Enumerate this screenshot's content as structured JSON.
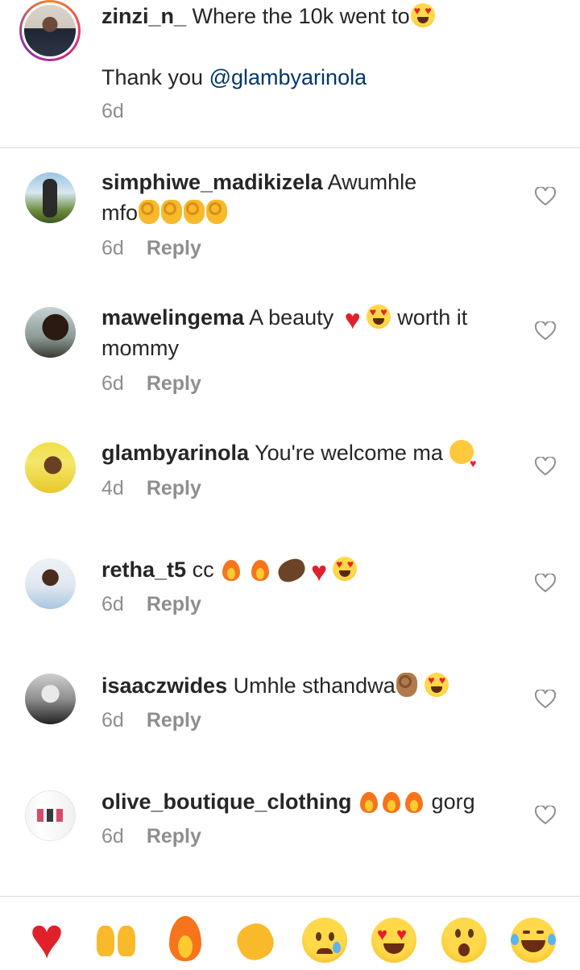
{
  "caption": {
    "username": "zinzi_n_",
    "text": "Where the 10k went to",
    "thanks": "Thank you",
    "mention": "@glambyarinola",
    "time": "6d"
  },
  "comments": [
    {
      "username": "simphiwe_madikizela",
      "text": "Awumhle",
      "text2": "mfo",
      "time": "6d",
      "reply": "Reply"
    },
    {
      "username": "mawelingema",
      "text": "A beauty",
      "text_after": "worth it",
      "text2": "mommy",
      "time": "6d",
      "reply": "Reply"
    },
    {
      "username": "glambyarinola",
      "text": "You're welcome ma",
      "time": "4d",
      "reply": "Reply"
    },
    {
      "username": "retha_t5",
      "text": "cc",
      "time": "6d",
      "reply": "Reply"
    },
    {
      "username": "isaaczwides",
      "text": "Umhle sthandwa",
      "time": "6d",
      "reply": "Reply"
    },
    {
      "username": "olive_boutique_clothing",
      "text": "gorg",
      "time": "6d",
      "reply": "Reply"
    }
  ],
  "reactions": [
    "red-heart",
    "raising-hands",
    "fire",
    "clapping-hands",
    "sad-tear-face",
    "heart-eyes-face",
    "surprised-face",
    "tears-of-joy-face"
  ],
  "colors": {
    "mention": "#00376b",
    "meta": "#8e8e8e",
    "divider": "#dbdbdb",
    "heart": "#e0212b"
  }
}
